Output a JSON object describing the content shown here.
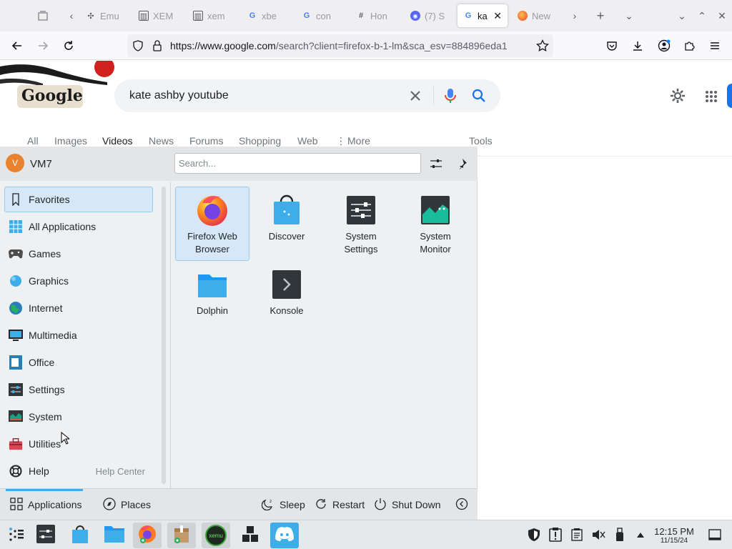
{
  "browser": {
    "tabs": [
      {
        "label": "Emu",
        "favicon": "puzzle-icon",
        "active": false
      },
      {
        "label": "XEM",
        "favicon": "archive-icon",
        "active": false
      },
      {
        "label": "xem",
        "favicon": "archive-icon",
        "active": false
      },
      {
        "label": "xbe",
        "favicon": "google-icon",
        "active": false
      },
      {
        "label": "con",
        "favicon": "google-icon",
        "active": false
      },
      {
        "label": "Hon",
        "favicon": "hash-icon",
        "active": false
      },
      {
        "label": "(7) S",
        "favicon": "discord-icon",
        "active": false
      },
      {
        "label": "ka",
        "favicon": "google-icon",
        "active": true
      },
      {
        "label": "New",
        "favicon": "firefox-icon",
        "active": false
      }
    ],
    "url_prefix": "https://www.google.com",
    "url_rest": "/search?client=firefox-b-1-lm&sca_esv=884896eda1"
  },
  "google": {
    "logo_text": "Google",
    "query": "kate ashby youtube",
    "tabs": [
      "All",
      "Images",
      "Videos",
      "News",
      "Forums",
      "Shopping",
      "Web",
      "More"
    ],
    "selected_tab": "Videos",
    "tools_label": "Tools"
  },
  "launcher": {
    "user_initial": "V",
    "user_name": "VM7",
    "search_placeholder": "Search...",
    "categories": [
      {
        "label": "Favorites",
        "icon": "bookmark-icon"
      },
      {
        "label": "All Applications",
        "icon": "grid-icon"
      },
      {
        "label": "Games",
        "icon": "gamepad-icon"
      },
      {
        "label": "Graphics",
        "icon": "graphics-icon"
      },
      {
        "label": "Internet",
        "icon": "globe-icon"
      },
      {
        "label": "Multimedia",
        "icon": "multimedia-icon"
      },
      {
        "label": "Office",
        "icon": "office-icon"
      },
      {
        "label": "Settings",
        "icon": "settings-icon"
      },
      {
        "label": "System",
        "icon": "system-icon"
      },
      {
        "label": "Utilities",
        "icon": "toolbox-icon"
      },
      {
        "label": "Help",
        "icon": "lifebuoy-icon"
      }
    ],
    "help_center": "Help Center",
    "apps": [
      {
        "line1": "Firefox Web",
        "line2": "Browser",
        "icon": "firefox-icon"
      },
      {
        "line1": "Discover",
        "line2": "",
        "icon": "discover-icon"
      },
      {
        "line1": "System",
        "line2": "Settings",
        "icon": "system-settings-icon"
      },
      {
        "line1": "System",
        "line2": "Monitor",
        "icon": "system-monitor-icon"
      },
      {
        "line1": "Dolphin",
        "line2": "",
        "icon": "folder-icon"
      },
      {
        "line1": "Konsole",
        "line2": "",
        "icon": "terminal-icon"
      }
    ],
    "footer": {
      "applications": "Applications",
      "places": "Places",
      "sleep": "Sleep",
      "restart": "Restart",
      "shutdown": "Shut Down"
    }
  },
  "taskbar": {
    "xemu_label": "xemu",
    "time": "12:15 PM",
    "date": "11/15/24"
  },
  "colors": {
    "accent": "#3daee9",
    "selection": "#d6e7f7",
    "google_blue": "#1a73e8"
  }
}
